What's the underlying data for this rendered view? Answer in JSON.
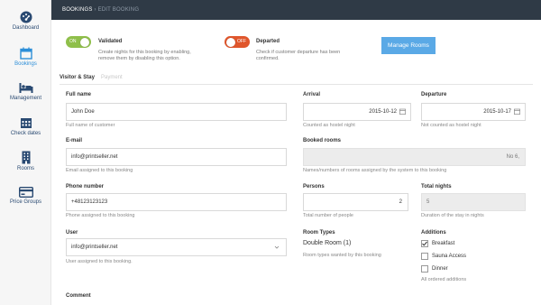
{
  "nav": {
    "dashboard": "Dashboard",
    "bookings": "Bookings",
    "management": "Management",
    "check_dates": "Check dates",
    "rooms": "Rooms",
    "price_groups": "Price Groups"
  },
  "breadcrumb": {
    "main": "BOOKINGS",
    "separator": "›",
    "sub": "EDIT BOOKING"
  },
  "validated": {
    "toggle_text": "ON",
    "title": "Validated",
    "help_line1": "Create nights for this booking by enabling,",
    "help_line2": "remove them by disabling this option."
  },
  "departed": {
    "toggle_text": "OFF",
    "title": "Departed",
    "help_line1": "Check if customer departure has been",
    "help_line2": "confirmed."
  },
  "manage_rooms_label": "Manage Rooms",
  "tabs": {
    "visitor_stay": "Visitor & Stay",
    "payment": "Payment"
  },
  "form": {
    "full_name": {
      "label": "Full name",
      "value": "John Doe",
      "hint": "Full name of customer"
    },
    "email": {
      "label": "E-mail",
      "value": "info@printseller.net",
      "hint": "Email assigned to this booking"
    },
    "phone": {
      "label": "Phone number",
      "value": "+48123123123",
      "hint": "Phone assigned to this booking"
    },
    "user": {
      "label": "User",
      "value": "info@printseller.net",
      "hint": "User assigned to this booking."
    },
    "comment": {
      "label": "Comment"
    },
    "arrival": {
      "label": "Arrival",
      "value": "2015-10-12",
      "hint": "Counted as hostel night"
    },
    "departure": {
      "label": "Departure",
      "value": "2015-10-17",
      "hint": "Not counted as hostel night"
    },
    "booked_rooms": {
      "label": "Booked rooms",
      "value": "No 6,",
      "hint": "Names/numbers of rooms assigned by the system to this booking"
    },
    "persons": {
      "label": "Persons",
      "value": "2",
      "hint": "Total number of people"
    },
    "total_nights": {
      "label": "Total nights",
      "value": "5",
      "hint": "Duration of the stay in nights"
    },
    "room_types": {
      "label": "Room Types",
      "value": "Double Room (1)",
      "hint": "Room types wanted by this booking"
    },
    "additions": {
      "label": "Additions",
      "items": [
        {
          "label": "Breakfast",
          "checked": true
        },
        {
          "label": "Sauna Access",
          "checked": false
        },
        {
          "label": "Dinner",
          "checked": false
        }
      ],
      "hint": "All ordered additions"
    }
  },
  "colors": {
    "accent": "#5aa9e6",
    "on": "#8fbf4a",
    "off": "#e0562c",
    "topbar": "#2f3a46",
    "nav": "#2a4a72"
  }
}
